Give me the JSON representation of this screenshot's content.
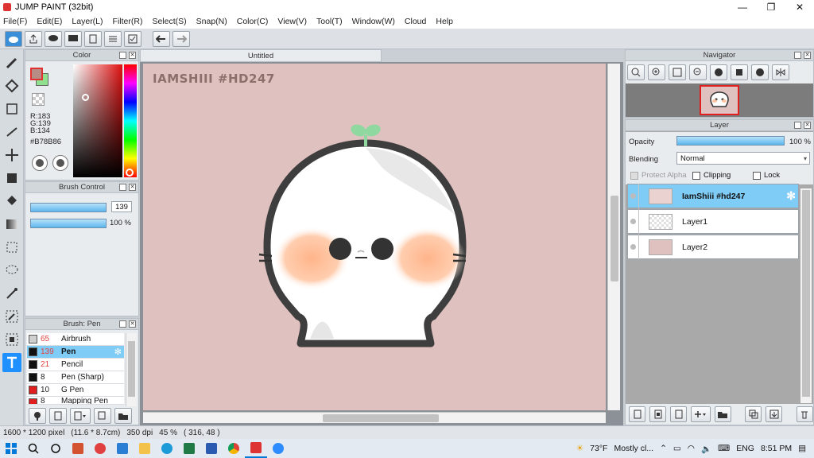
{
  "window": {
    "title": "JUMP PAINT (32bit)",
    "controls": [
      "—",
      "❐",
      "✕"
    ]
  },
  "menu": [
    "File(F)",
    "Edit(E)",
    "Layer(L)",
    "Filter(R)",
    "Select(S)",
    "Snap(N)",
    "Color(C)",
    "View(V)",
    "Tool(T)",
    "Window(W)",
    "Cloud",
    "Help"
  ],
  "color_panel": {
    "title": "Color",
    "rgb": {
      "r": "R:183",
      "g": "G:139",
      "b": "B:134"
    },
    "hex": "#B78B86",
    "main_color": "#b78b86",
    "sub_color": "#8fe08f"
  },
  "brush_control": {
    "title": "Brush Control",
    "size": "139",
    "opacity": "100 %"
  },
  "brush_panel": {
    "title": "Brush: Pen",
    "items": [
      {
        "size": "65",
        "name": "Airbrush",
        "color": "#cfcfcf"
      },
      {
        "size": "139",
        "name": "Pen",
        "color": "#111111",
        "selected": true
      },
      {
        "size": "21",
        "name": "Pencil",
        "color": "#111111"
      },
      {
        "size": "8",
        "name": "Pen (Sharp)",
        "color": "#111111"
      },
      {
        "size": "10",
        "name": "G Pen",
        "color": "#e02020"
      },
      {
        "size": "8",
        "name": "Mapping Pen",
        "color": "#e02020"
      }
    ]
  },
  "document": {
    "tab": "Untitled",
    "watermark": "IAMSHIII #HD247"
  },
  "navigator": {
    "title": "Navigator"
  },
  "layer_panel": {
    "title": "Layer",
    "opacity_label": "Opacity",
    "opacity_value": "100 %",
    "blending_label": "Blending",
    "blending_value": "Normal",
    "protect_alpha": "Protect Alpha",
    "clipping": "Clipping",
    "lock": "Lock",
    "layers": [
      {
        "name": "IamShiii #hd247",
        "selected": true
      },
      {
        "name": "Layer1",
        "selected": false
      },
      {
        "name": "Layer2",
        "selected": false
      }
    ]
  },
  "status": {
    "size": "1600 * 1200 pixel",
    "physical": "(11.6 * 8.7cm)",
    "dpi": "350 dpi",
    "zoom": "45 %",
    "coords": "( 316, 48 )"
  },
  "taskbar": {
    "weather_temp": "73°F",
    "weather_text": "Mostly cl...",
    "lang": "ENG",
    "time": "8:51 PM"
  }
}
